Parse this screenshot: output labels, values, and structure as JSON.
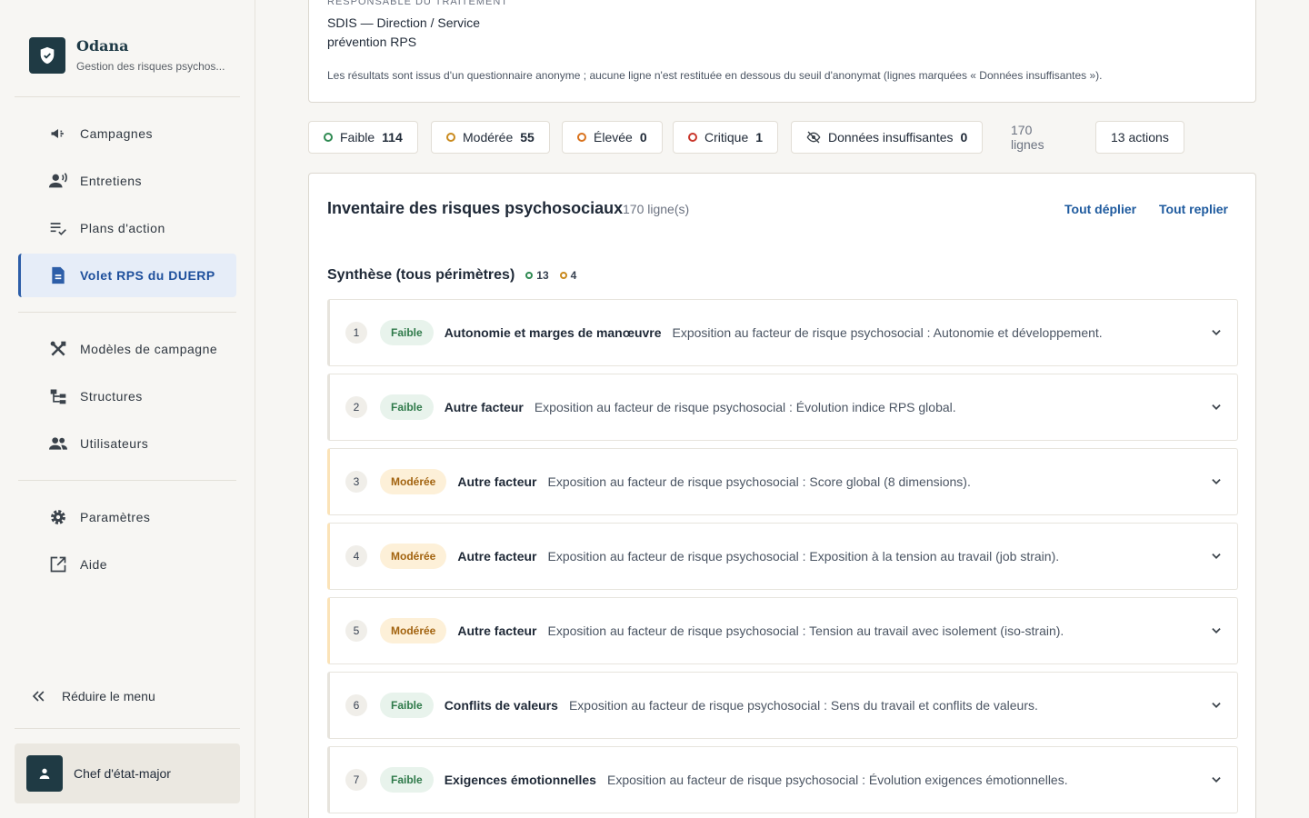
{
  "brand": {
    "name": "Odana",
    "subtitle": "Gestion des risques psychos..."
  },
  "nav": {
    "campagnes": "Campagnes",
    "entretiens": "Entretiens",
    "plans": "Plans d'action",
    "volet": "Volet RPS du DUERP",
    "modeles": "Modèles de campagne",
    "structures": "Structures",
    "utilisateurs": "Utilisateurs",
    "parametres": "Paramètres",
    "aide": "Aide",
    "collapse": "Réduire le menu"
  },
  "user": {
    "name": "Chef d'état-major"
  },
  "info": {
    "label": "Responsable du traitement",
    "value": "SDIS — Direction / Service prévention RPS",
    "note": "Les résultats sont issus d'un questionnaire anonyme ; aucune ligne n'est restituée en dessous du seuil d'anonymat (lignes marquées « Données insuffisantes »)."
  },
  "filters": {
    "faible": {
      "label": "Faible",
      "count": "114"
    },
    "moderee": {
      "label": "Modérée",
      "count": "55"
    },
    "elevee": {
      "label": "Élevée",
      "count": "0"
    },
    "critique": {
      "label": "Critique",
      "count": "1"
    },
    "insuffisantes": {
      "label": "Données insuffisantes",
      "count": "0"
    },
    "lines": "170 lignes",
    "actions": "13 actions"
  },
  "colors": {
    "faible": "#2f8a52",
    "moderee": "#c98a1e",
    "elevee": "#d9731e",
    "critique": "#c9372c"
  },
  "inventory": {
    "title": "Inventaire des risques psychosociaux",
    "count": "170 ligne(s)",
    "expand_all": "Tout déplier",
    "collapse_all": "Tout replier",
    "section_title": "Synthèse (tous périmètres)",
    "section_low_count": "13",
    "section_mid_count": "4",
    "rows": [
      {
        "num": "1",
        "level": "Faible",
        "factor": "Autonomie et marges de manœuvre",
        "desc": "Exposition au facteur de risque psychosocial : Autonomie et développement."
      },
      {
        "num": "2",
        "level": "Faible",
        "factor": "Autre facteur",
        "desc": "Exposition au facteur de risque psychosocial : Évolution indice RPS global."
      },
      {
        "num": "3",
        "level": "Modérée",
        "factor": "Autre facteur",
        "desc": "Exposition au facteur de risque psychosocial : Score global (8 dimensions)."
      },
      {
        "num": "4",
        "level": "Modérée",
        "factor": "Autre facteur",
        "desc": "Exposition au facteur de risque psychosocial : Exposition à la tension au travail (job strain)."
      },
      {
        "num": "5",
        "level": "Modérée",
        "factor": "Autre facteur",
        "desc": "Exposition au facteur de risque psychosocial : Tension au travail avec isolement (iso-strain)."
      },
      {
        "num": "6",
        "level": "Faible",
        "factor": "Conflits de valeurs",
        "desc": "Exposition au facteur de risque psychosocial : Sens du travail et conflits de valeurs."
      },
      {
        "num": "7",
        "level": "Faible",
        "factor": "Exigences émotionnelles",
        "desc": "Exposition au facteur de risque psychosocial : Évolution exigences émotionnelles."
      }
    ]
  }
}
